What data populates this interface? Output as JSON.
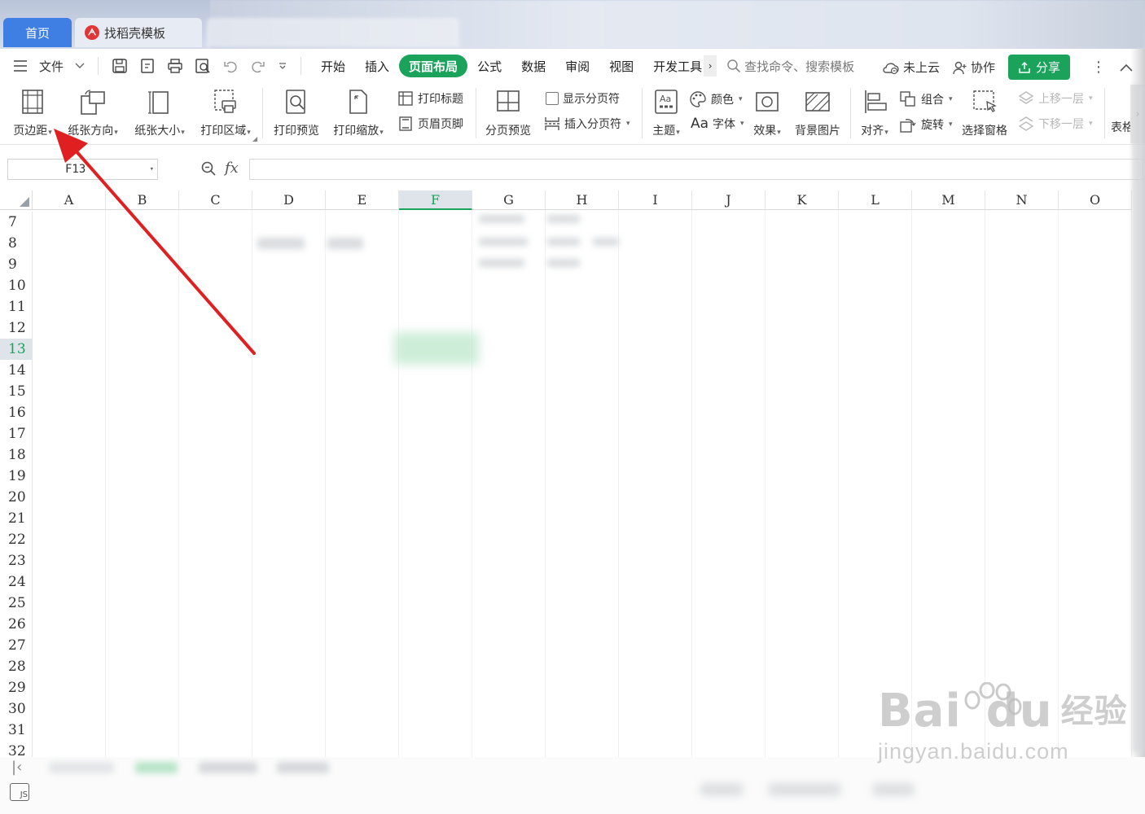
{
  "tabs": {
    "home_label": "首页",
    "template_label": "找稻壳模板"
  },
  "menu": {
    "file_label": "文件",
    "items": [
      "开始",
      "插入",
      "页面布局",
      "公式",
      "数据",
      "审阅",
      "视图",
      "开发工具"
    ],
    "active": "页面布局",
    "search_placeholder": "查找命令、搜索模板",
    "cloud_label": "未上云",
    "collab_label": "协作",
    "share_label": "分享"
  },
  "ribbon": {
    "margins": "页边距",
    "orientation": "纸张方向",
    "size": "纸张大小",
    "print_area": "打印区域",
    "print_preview": "打印预览",
    "print_scale": "打印缩放",
    "print_titles": "打印标题",
    "header_footer": "页眉页脚",
    "page_break_preview": "分页预览",
    "show_page_breaks": "显示分页符",
    "insert_page_break": "插入分页符",
    "theme": "主题",
    "colors": "颜色",
    "fonts": "字体",
    "fonts_prefix": "Aa",
    "effects": "效果",
    "background": "背景图片",
    "align": "对齐",
    "group": "组合",
    "rotate": "旋转",
    "selection_pane": "选择窗格",
    "bring_forward": "上移一层",
    "send_backward": "下移一层",
    "cut_off": "表格"
  },
  "formula_bar": {
    "name_box": "F13",
    "fx_label": "fx",
    "formula": ""
  },
  "grid": {
    "columns": [
      "A",
      "B",
      "C",
      "D",
      "E",
      "F",
      "G",
      "H",
      "I",
      "J",
      "K",
      "L",
      "M",
      "N",
      "O"
    ],
    "selected_column": "F",
    "rows": [
      "7",
      "8",
      "9",
      "10",
      "11",
      "12",
      "13",
      "14",
      "15",
      "16",
      "17",
      "18",
      "19",
      "20",
      "21",
      "22",
      "23",
      "24",
      "25",
      "26",
      "27",
      "28",
      "29",
      "30",
      "31",
      "32"
    ],
    "selected_row": "13"
  },
  "watermark": {
    "brand": "Bai",
    "brand2": "du",
    "cn": "经验",
    "url": "jingyan.baidu.com"
  },
  "colors": {
    "accent_green": "#1ba35c",
    "tab_blue": "#3f7ee3",
    "arrow_red": "#e02020"
  }
}
